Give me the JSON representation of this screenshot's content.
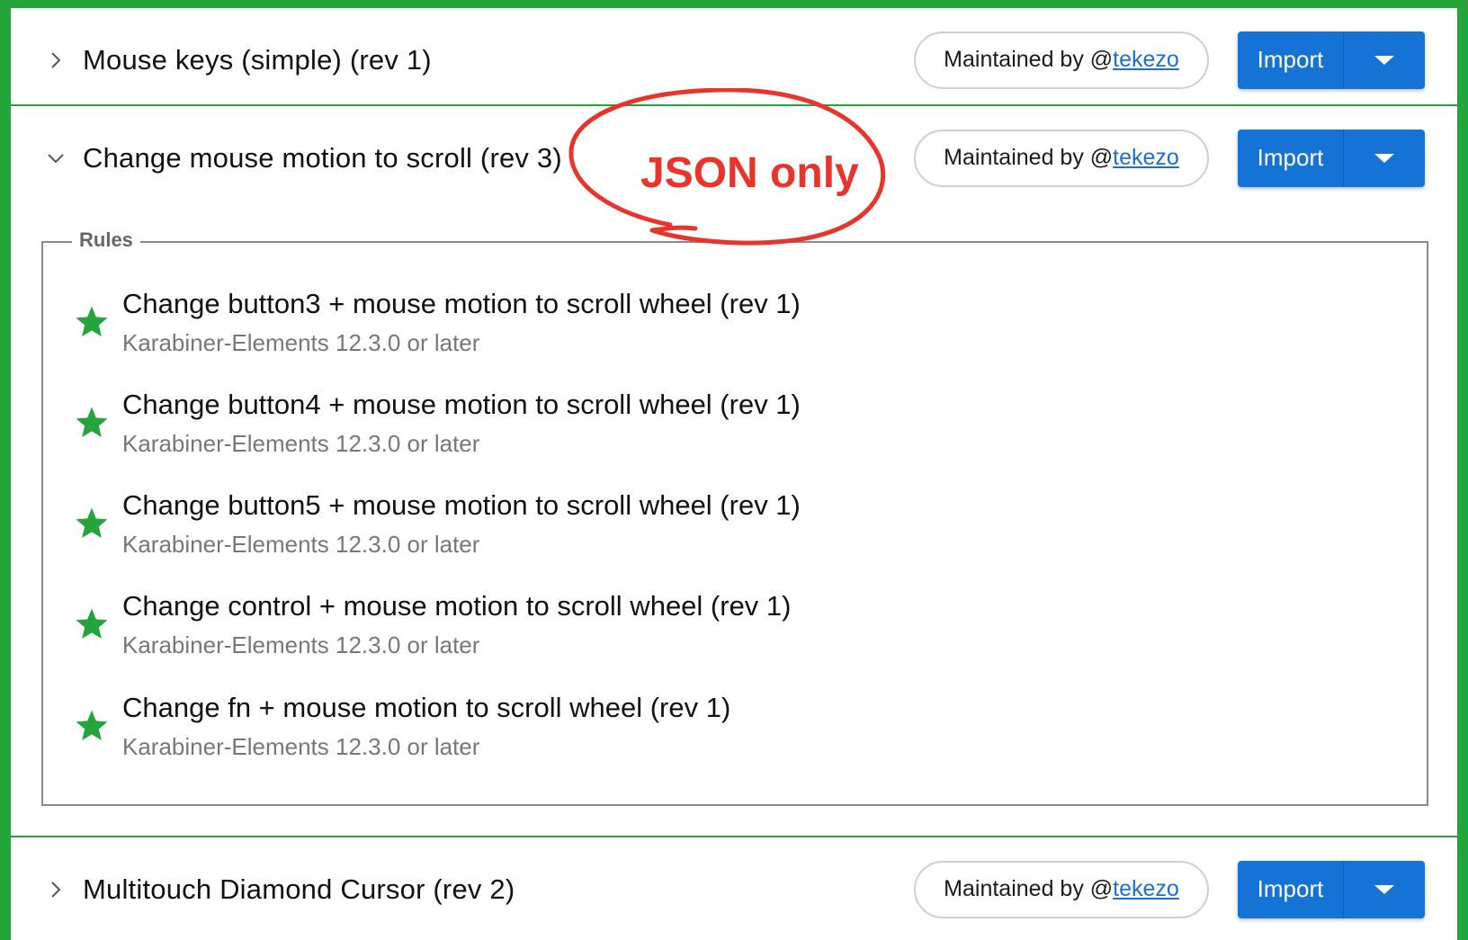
{
  "colors": {
    "accent": "#23a53b",
    "primary": "#1573d6",
    "star": "#23a53b",
    "annotation": "#e8342a"
  },
  "rows": [
    {
      "title": "Mouse keys (simple) (rev 1)",
      "expanded": false,
      "maintained_prefix": "Maintained by @",
      "maintainer": "tekezo",
      "import_label": "Import"
    },
    {
      "title": "Change mouse motion to scroll (rev 3)",
      "expanded": true,
      "maintained_prefix": "Maintained by @",
      "maintainer": "tekezo",
      "import_label": "Import",
      "rules_legend": "Rules",
      "rules": [
        {
          "title": "Change button3 + mouse motion to scroll wheel (rev 1)",
          "subtitle": "Karabiner-Elements 12.3.0 or later"
        },
        {
          "title": "Change button4 + mouse motion to scroll wheel (rev 1)",
          "subtitle": "Karabiner-Elements 12.3.0 or later"
        },
        {
          "title": "Change button5 + mouse motion to scroll wheel (rev 1)",
          "subtitle": "Karabiner-Elements 12.3.0 or later"
        },
        {
          "title": "Change control + mouse motion to scroll wheel (rev 1)",
          "subtitle": "Karabiner-Elements 12.3.0 or later"
        },
        {
          "title": "Change fn + mouse motion to scroll wheel (rev 1)",
          "subtitle": "Karabiner-Elements 12.3.0 or later"
        }
      ]
    },
    {
      "title": "Multitouch Diamond Cursor (rev 2)",
      "expanded": false,
      "maintained_prefix": "Maintained by @",
      "maintainer": "tekezo",
      "import_label": "Import"
    }
  ],
  "annotation": {
    "text": "JSON only"
  }
}
